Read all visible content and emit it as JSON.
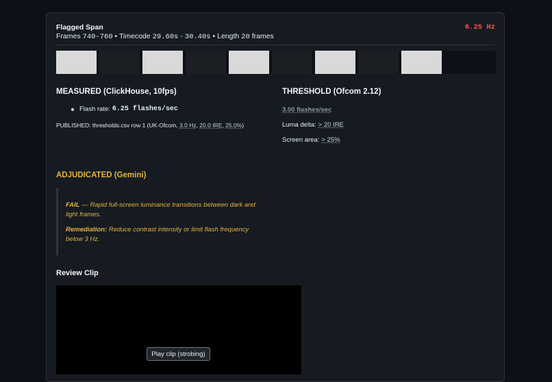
{
  "header": {
    "title": "Flagged Span",
    "frames_label": "Frames",
    "frames_value": "740-760",
    "timecode_label": "Timecode",
    "timecode_start": "29.60s",
    "timecode_end": "30.40s",
    "length_label": "Length",
    "length_value": "20",
    "length_unit": "frames",
    "flash_hz": "6.25 Hz",
    "separator": "•",
    "dash": "-"
  },
  "frame_strip": [
    "light",
    "dark",
    "light",
    "dark",
    "light",
    "dark",
    "light",
    "dark",
    "light",
    "empty"
  ],
  "measured": {
    "title": "MEASURED (ClickHouse, 10fps)",
    "flash_rate_label": "Flash rate:",
    "flash_rate_value": "6.25 flashes/sec",
    "published_prefix": "PUBLISHED: thresholds.csv row 1 (UK-Ofcom,",
    "published_hz": "3.0 Hz",
    "published_ire": "20.0 IRE",
    "published_area": "25.0%",
    "published_suffix": ")"
  },
  "threshold": {
    "title": "THRESHOLD (Ofcom 2.12)",
    "rate": "3.00 flashes/sec",
    "luma_label": "Luma delta:",
    "luma_value": "> 20 IRE",
    "area_label": "Screen area:",
    "area_value": "> 25%"
  },
  "adjudicated": {
    "title": "ADJUDICATED (Gemini)",
    "verdict": "FAIL",
    "verdict_text": "— Rapid full-screen luminance transitions between dark and light frames.",
    "remediation_label": "Remediation:",
    "remediation_text": "Reduce contrast intensity or limit flash frequency below 3 Hz."
  },
  "review": {
    "title": "Review Clip",
    "play_label": "Play clip (strobing)"
  },
  "colors": {
    "background": "#0d1117",
    "card": "#161b22",
    "hz_red": "#f85149",
    "adjudicated_amber": "#e3b341"
  }
}
